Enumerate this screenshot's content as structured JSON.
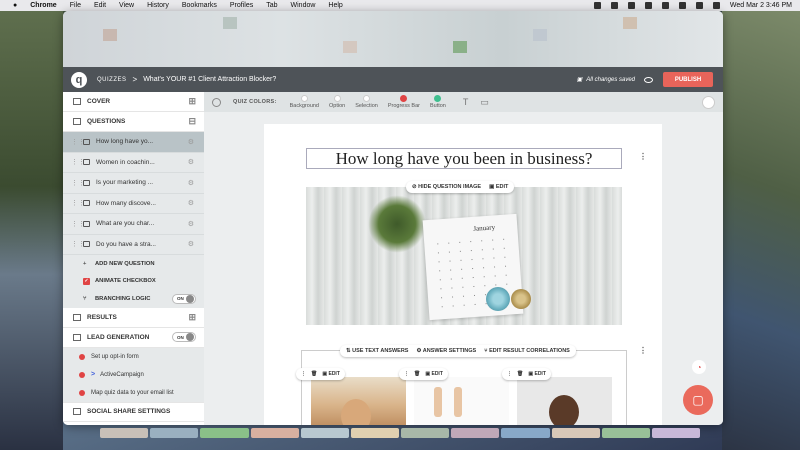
{
  "menubar": {
    "apple": "",
    "app": "Chrome",
    "menus": [
      "File",
      "Edit",
      "View",
      "History",
      "Bookmarks",
      "Profiles",
      "Tab",
      "Window",
      "Help"
    ],
    "datetime": "Wed Mar 2  3:46 PM"
  },
  "appbar": {
    "logo": "q",
    "crumb": "QUIZZES",
    "separator": ">",
    "title": "What's YOUR #1 Client Attraction Blocker?",
    "saved": "All changes saved",
    "publish": "PUBLISH"
  },
  "sidebar": {
    "cover": "COVER",
    "questions": "QUESTIONS",
    "question_items": [
      "How long have yo...",
      "Women in coachin...",
      "Is your marketing ...",
      "How many discove...",
      "What are you char...",
      "Do you have a stra..."
    ],
    "add_question": "ADD NEW QUESTION",
    "animate_checkbox": "ANIMATE CHECKBOX",
    "branching_logic": "BRANCHING LOGIC",
    "toggle_on": "ON",
    "results": "RESULTS",
    "lead_generation": "LEAD GENERATION",
    "lead_items": [
      "Set up opt-in form",
      "ActiveCampaign",
      "Map quiz data to your email list"
    ],
    "social_share": "SOCIAL SHARE SETTINGS"
  },
  "toolbar": {
    "label": "QUIZ COLORS:",
    "swatches": [
      {
        "name": "Background",
        "color": "#ffffff"
      },
      {
        "name": "Option",
        "color": "#ffffff"
      },
      {
        "name": "Selection",
        "color": "#ffffff"
      },
      {
        "name": "Progress Bar",
        "color": "#e04444"
      },
      {
        "name": "Button",
        "color": "#3fbf8f"
      }
    ]
  },
  "editor": {
    "question_title": "How long have you been in business?",
    "hide_image": "HIDE QUESTION IMAGE",
    "edit": "EDIT",
    "calendar_month": "January",
    "use_text_answers": "USE TEXT ANSWERS",
    "answer_settings": "ANSWER SETTINGS",
    "edit_correlations": "EDIT RESULT CORRELATIONS"
  },
  "colors": {
    "accent": "#e8645a",
    "appbar": "#4e5358",
    "sidebar_active": "#b9c3c7"
  }
}
